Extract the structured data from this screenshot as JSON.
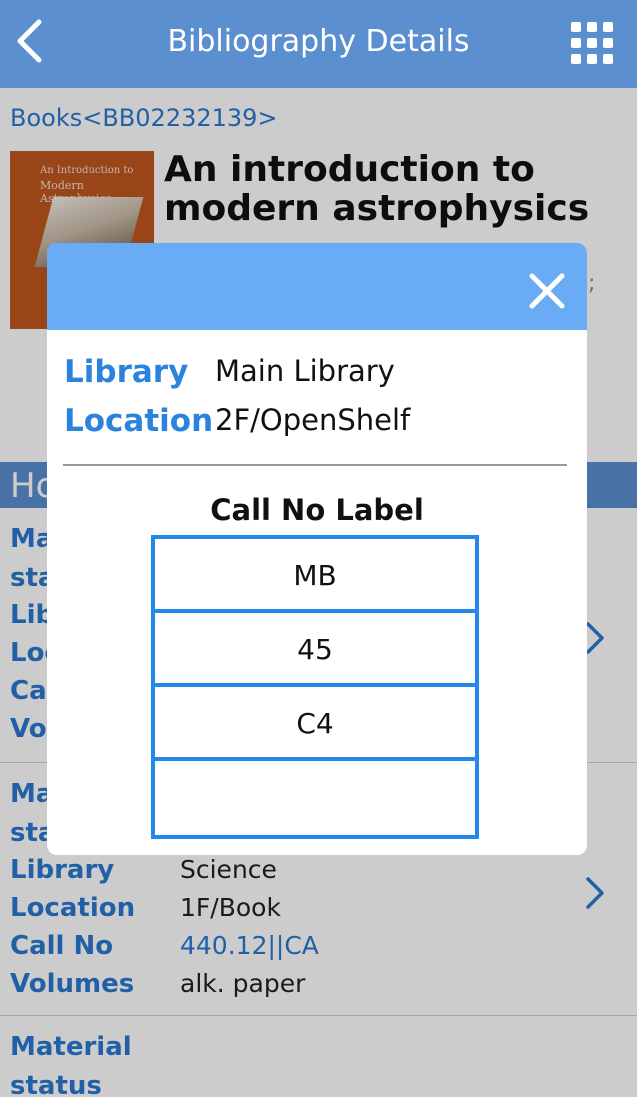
{
  "navbar": {
    "title": "Bibliography Details"
  },
  "book": {
    "breadcrumb": "Books<BB02232139>",
    "title_line1": "An introduction to",
    "title_line2": "modern astrophysics",
    "cover_text_line1": "An Introduction to",
    "cover_text_line2": "Modern Astrophysics",
    "partial_text": ";"
  },
  "holdings": {
    "header": "Ho",
    "block1": {
      "labels": [
        "Ma",
        "sta",
        "Lib",
        "Loc",
        "Ca",
        "Vo"
      ]
    },
    "block2": {
      "material_label_1": "Ma",
      "material_label_2": "sta",
      "library_label": "Library",
      "library_value": "Science",
      "location_label": "Location",
      "location_value": "1F/Book",
      "callno_label": "Call No",
      "callno_value": "440.12||CA",
      "volumes_label": "Volumes",
      "volumes_value": "alk. paper"
    },
    "block3": {
      "material_label_1": "Material",
      "material_label_2": "status"
    }
  },
  "modal": {
    "library_label": "Library",
    "library_value": "Main Library",
    "location_label": "Location",
    "location_value": "2F/OpenShelf",
    "call_title": "Call No Label",
    "call_label_lines": [
      "MB",
      "45",
      "C4",
      ""
    ]
  },
  "colors": {
    "navbar": "#5b8fcf",
    "modal_header": "#6aabf6",
    "accent": "#2a78d0",
    "label_border": "#2288ee"
  }
}
